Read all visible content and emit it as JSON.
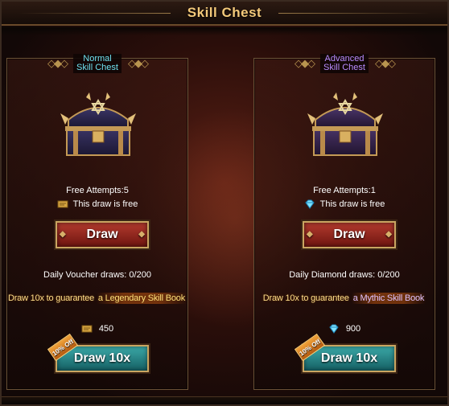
{
  "window": {
    "title": "Skill Chest"
  },
  "panels": [
    {
      "title_line1": "Normal",
      "title_line2": "Skill Chest",
      "free_attempts": "Free Attempts:5",
      "free_text": "This draw is free",
      "currency_icon": "voucher-icon",
      "draw_label": "Draw",
      "daily": "Daily Voucher draws: 0/200",
      "guarantee_prefix": "Draw 10x to guarantee",
      "guarantee_item": "a Legendary Skill Book",
      "cost": "450",
      "discount": "10% Off",
      "draw10_label": "Draw 10x"
    },
    {
      "title_line1": "Advanced",
      "title_line2": "Skill Chest",
      "free_attempts": "Free Attempts:1",
      "free_text": "This draw is free",
      "currency_icon": "diamond-icon",
      "draw_label": "Draw",
      "daily": "Daily Diamond draws: 0/200",
      "guarantee_prefix": "Draw 10x to guarantee",
      "guarantee_item": "a Mythic Skill Book",
      "cost": "900",
      "discount": "10% Off",
      "draw10_label": "Draw 10x"
    }
  ],
  "colors": {
    "title": "#f3c97a",
    "normal_title": "#6fe0ef",
    "advanced_title": "#b98cff",
    "draw_button": "#b33a2e",
    "draw10_button": "#3ba9a8",
    "gold_border": "#c9a561"
  }
}
